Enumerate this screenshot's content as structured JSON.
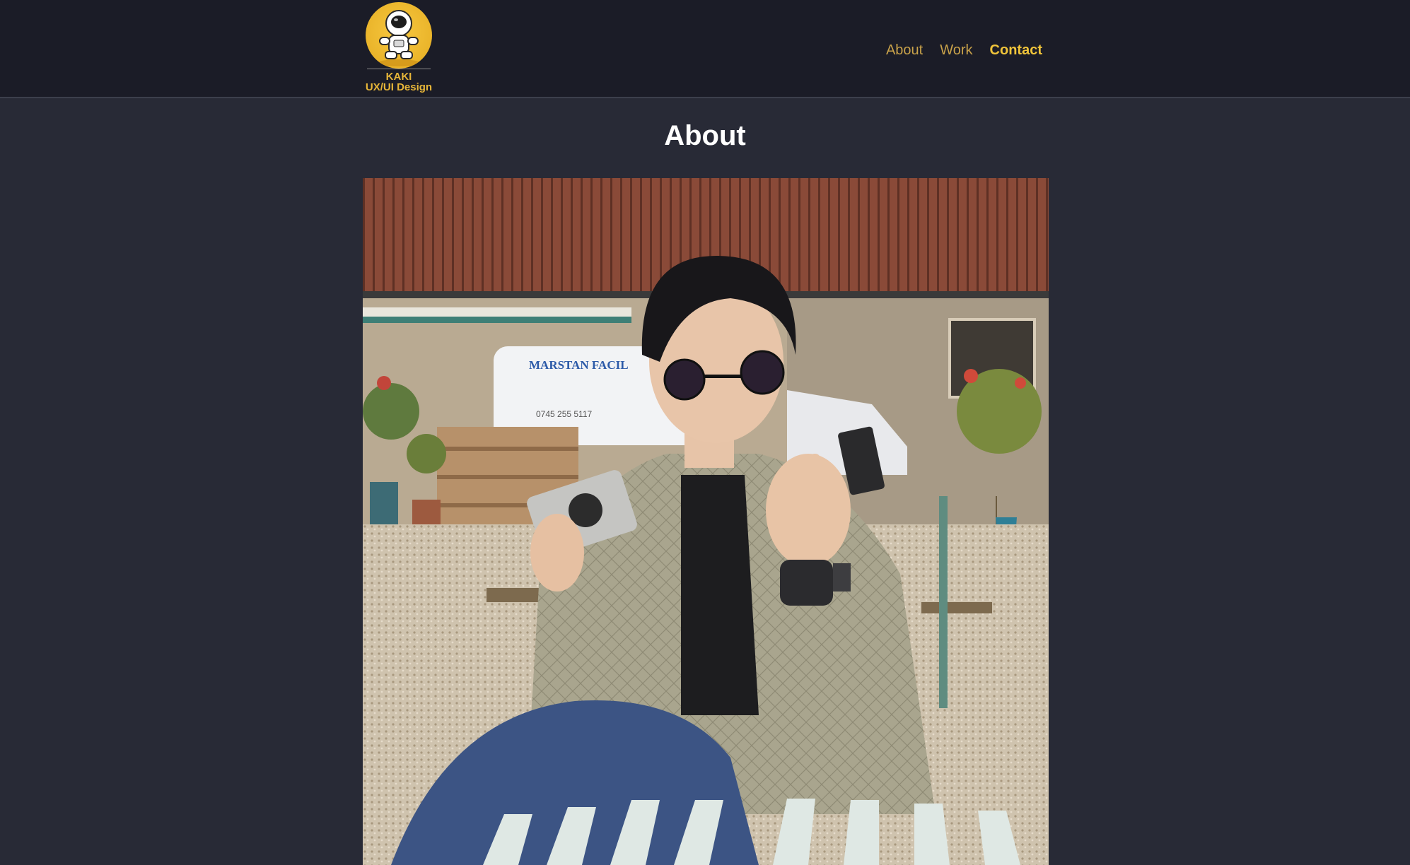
{
  "brand": {
    "name": "KAKI",
    "subtitle": "UX/UI Design",
    "icon": "astronaut-logo-icon",
    "color": "#e7b639"
  },
  "nav": {
    "items": [
      {
        "label": "About"
      },
      {
        "label": "Work"
      },
      {
        "label": "Contact",
        "active": true
      }
    ],
    "color": "#c9a24a",
    "active_color": "#f0c43a"
  },
  "main": {
    "title": "About",
    "photo": {
      "subject": "person-with-camera-photo",
      "van_lettering": "MARSTAN FACIL",
      "van_phone": "0745 255 5117"
    }
  },
  "colors": {
    "header_bg": "#1b1c27",
    "page_bg": "#282a36",
    "title": "#ffffff"
  }
}
